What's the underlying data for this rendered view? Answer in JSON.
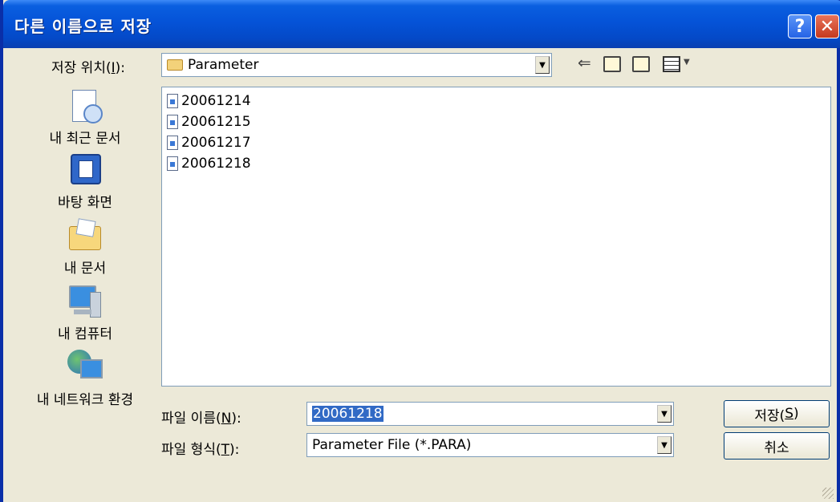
{
  "window": {
    "title": "다른 이름으로 저장",
    "help_label": "?",
    "close_label": "✕"
  },
  "save_in": {
    "label_prefix": "저장 위치(",
    "label_key": "I",
    "label_suffix": "):",
    "value": "Parameter"
  },
  "toolbar": {
    "back_icon": "back-arrow-icon",
    "up_icon": "up-folder-icon",
    "new_folder_icon": "new-folder-icon",
    "views_icon": "views-menu-icon"
  },
  "places": [
    {
      "label": "내 최근 문서",
      "icon": "recent-documents-icon"
    },
    {
      "label": "바탕 화면",
      "icon": "desktop-icon"
    },
    {
      "label": "내 문서",
      "icon": "my-documents-icon"
    },
    {
      "label": "내 컴퓨터",
      "icon": "my-computer-icon"
    },
    {
      "label": "내 네트워크 환경",
      "icon": "network-icon"
    }
  ],
  "files": [
    "20061214",
    "20061215",
    "20061217",
    "20061218"
  ],
  "filename": {
    "label_prefix": "파일 이름(",
    "label_key": "N",
    "label_suffix": "):",
    "value": "20061218"
  },
  "filetype": {
    "label_prefix": "파일 형식(",
    "label_key": "T",
    "label_suffix": "):",
    "value": "Parameter File (*.PARA)"
  },
  "buttons": {
    "save_prefix": "저장(",
    "save_key": "S",
    "save_suffix": ")",
    "cancel": "취소"
  }
}
